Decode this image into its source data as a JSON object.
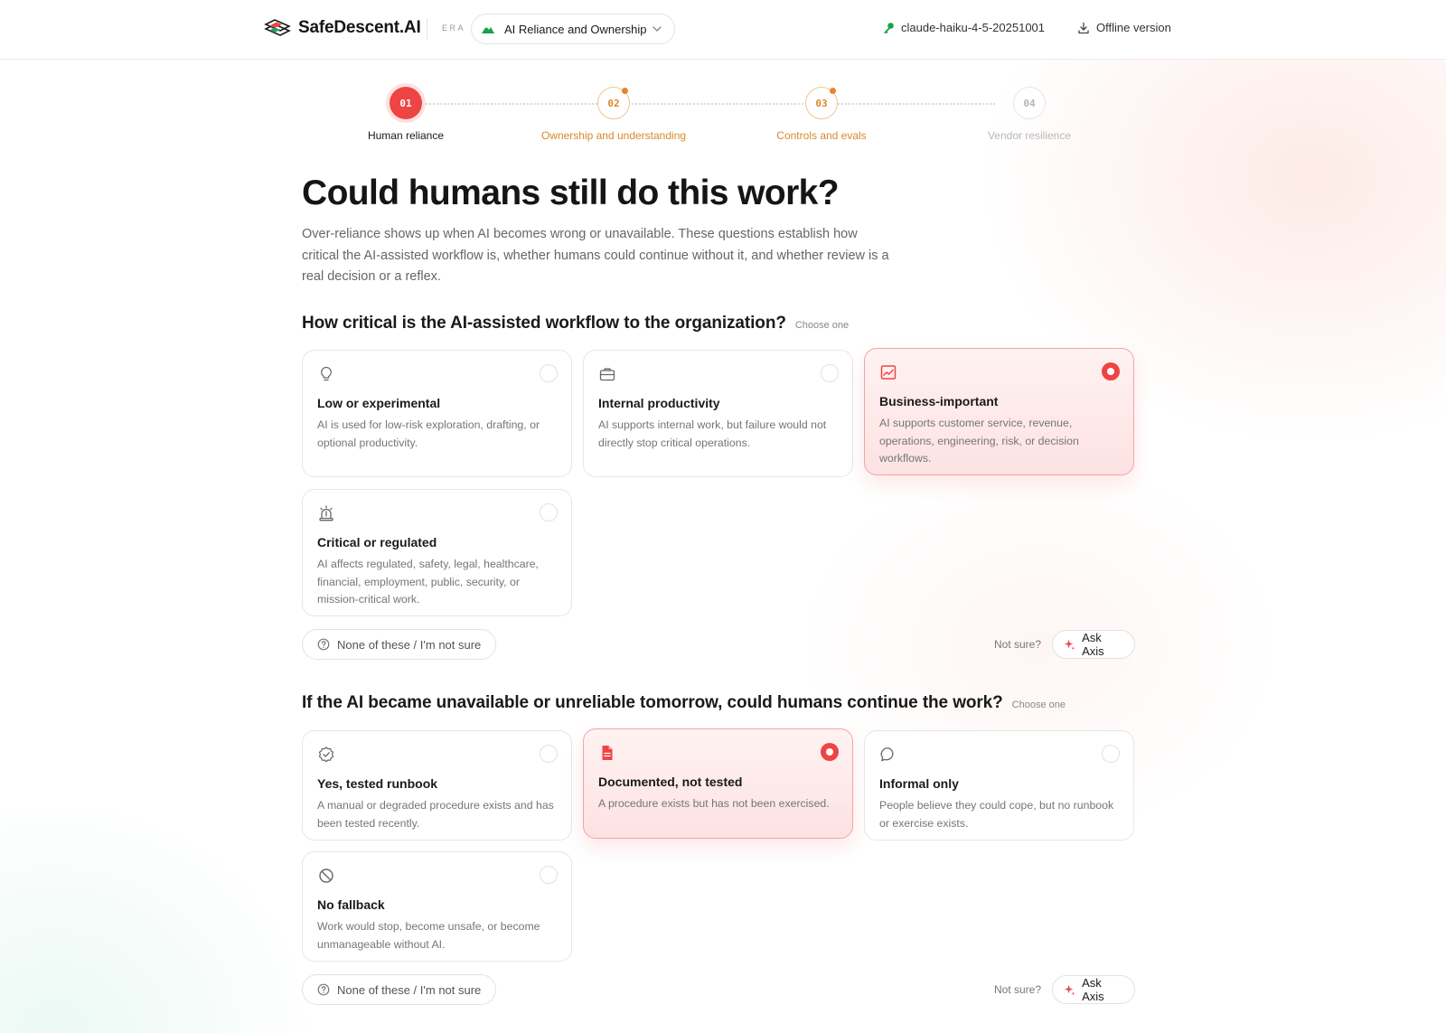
{
  "header": {
    "brand": "SafeDescent.AI",
    "era_label": "ERA",
    "era_value": "AI Reliance and Ownership",
    "model": "claude-haiku-4-5-20251001",
    "offline": "Offline version"
  },
  "steps": [
    {
      "num": "01",
      "label": "Human reliance",
      "state": "active"
    },
    {
      "num": "02",
      "label": "Ownership and understanding",
      "state": "warn"
    },
    {
      "num": "03",
      "label": "Controls and evals",
      "state": "warn"
    },
    {
      "num": "04",
      "label": "Vendor resilience",
      "state": "muted"
    }
  ],
  "page": {
    "title": "Could humans still do this work?",
    "intro": "Over-reliance shows up when AI becomes wrong or unavailable. These questions establish how critical the AI-assisted workflow is, whether humans could continue without it, and whether review is a real decision or a reflex."
  },
  "questions": [
    {
      "text": "How critical is the AI-assisted workflow to the organization?",
      "hint": "Choose one",
      "options": [
        {
          "icon": "lightbulb-icon",
          "title": "Low or experimental",
          "desc": "AI is used for low-risk exploration, drafting, or optional productivity.",
          "selected": false
        },
        {
          "icon": "briefcase-icon",
          "title": "Internal productivity",
          "desc": "AI supports internal work, but failure would not directly stop critical operations.",
          "selected": false
        },
        {
          "icon": "chart-icon",
          "title": "Business-important",
          "desc": "AI supports customer service, revenue, operations, engineering, risk, or decision workflows.",
          "selected": true
        },
        {
          "icon": "siren-icon",
          "title": "Critical or regulated",
          "desc": "AI affects regulated, safety, legal, healthcare, financial, employment, public, security, or mission-critical work.",
          "selected": false
        }
      ],
      "none_label": "None of these / I'm not sure",
      "not_sure": "Not sure?",
      "ask": "Ask Axis"
    },
    {
      "text": "If the AI became unavailable or unreliable tomorrow, could humans continue the work?",
      "hint": "Choose one",
      "options": [
        {
          "icon": "verified-badge-icon",
          "title": "Yes, tested runbook",
          "desc": "A manual or degraded procedure exists and has been tested recently.",
          "selected": false
        },
        {
          "icon": "document-icon",
          "title": "Documented, not tested",
          "desc": "A procedure exists but has not been exercised.",
          "selected": true
        },
        {
          "icon": "chat-bubble-icon",
          "title": "Informal only",
          "desc": "People believe they could cope, but no runbook or exercise exists.",
          "selected": false
        },
        {
          "icon": "ban-icon",
          "title": "No fallback",
          "desc": "Work would stop, become unsafe, or become unmanageable without AI.",
          "selected": false
        }
      ],
      "none_label": "None of these / I'm not sure",
      "not_sure": "Not sure?",
      "ask": "Ask Axis"
    }
  ],
  "colors": {
    "accent": "#ef4444",
    "warn": "#d8892a",
    "brand_green": "#16a34a"
  }
}
